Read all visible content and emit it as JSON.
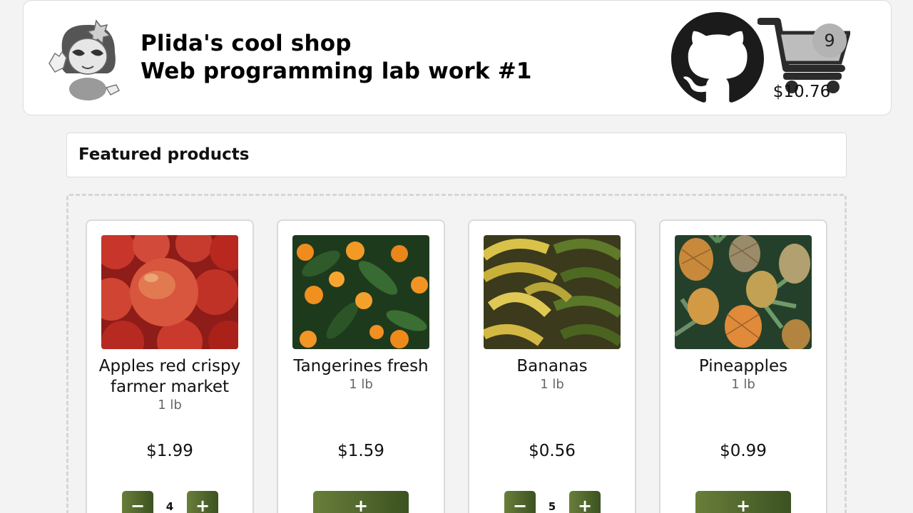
{
  "header": {
    "title": "Plida's cool shop",
    "subtitle": "Web programming lab work #1",
    "cart_count": "9",
    "cart_total": "$10.76"
  },
  "section": {
    "title": "Featured products"
  },
  "products": [
    {
      "name": "Apples red crispy farmer market",
      "unit": "1 lb",
      "price": "$1.99",
      "qty": "4",
      "minus": "−",
      "plus": "+"
    },
    {
      "name": "Tangerines fresh",
      "unit": "1 lb",
      "price": "$1.59",
      "plus": "+"
    },
    {
      "name": "Bananas",
      "unit": "1 lb",
      "price": "$0.56",
      "qty": "5",
      "minus": "−",
      "plus": "+"
    },
    {
      "name": "Pineapples",
      "unit": "1 lb",
      "price": "$0.99",
      "plus": "+"
    }
  ],
  "icons": {
    "github": "github-icon",
    "cart": "shopping-cart-icon",
    "mascot": "mascot-logo"
  },
  "colors": {
    "button_start": "#6a7e3a",
    "button_end": "#3b5221",
    "badge": "#b3b3b3"
  }
}
